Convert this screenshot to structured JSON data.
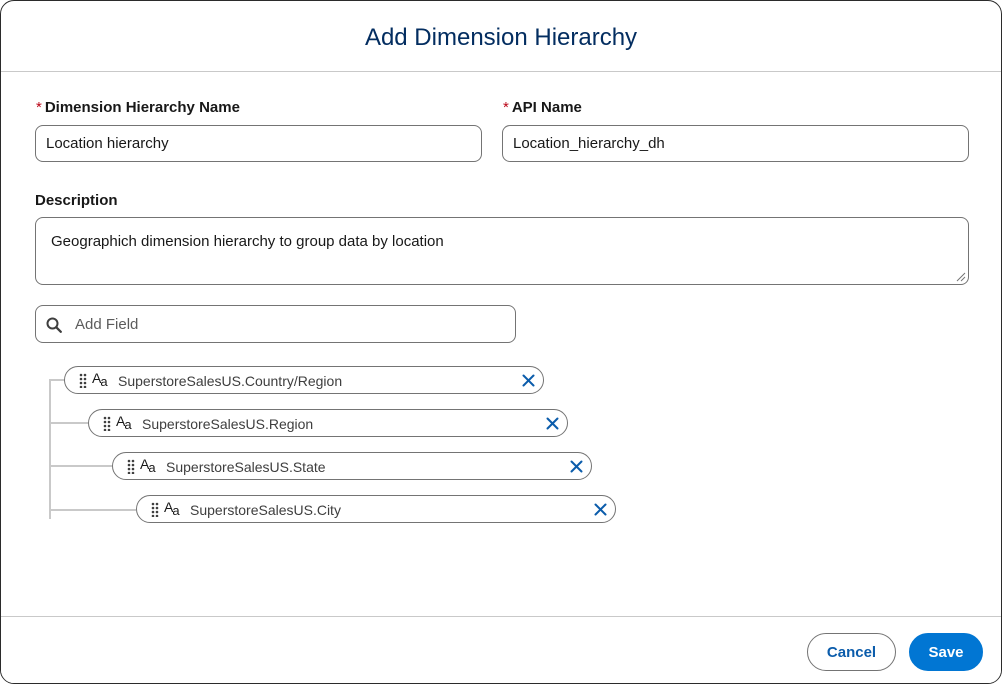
{
  "modal": {
    "title": "Add Dimension Hierarchy"
  },
  "form": {
    "name_label": "Dimension Hierarchy Name",
    "name_value": "Location hierarchy",
    "api_label": "API Name",
    "api_value": "Location_hierarchy_dh",
    "required_marker": "*",
    "description_label": "Description",
    "description_value": "Geographich dimension hierarchy to group data by location"
  },
  "search": {
    "placeholder": "Add Field",
    "icon": "search-icon"
  },
  "hierarchy": {
    "field_type_glyph": "A",
    "field_type_glyph_sub": "a",
    "fields": [
      "SuperstoreSalesUS.Country/Region",
      "SuperstoreSalesUS.Region",
      "SuperstoreSalesUS.State",
      "SuperstoreSalesUS.City"
    ]
  },
  "footer": {
    "cancel_label": "Cancel",
    "save_label": "Save"
  },
  "colors": {
    "title": "#032d60",
    "brand": "#0176d3",
    "link": "#0b5cab",
    "required": "#ba0517"
  }
}
